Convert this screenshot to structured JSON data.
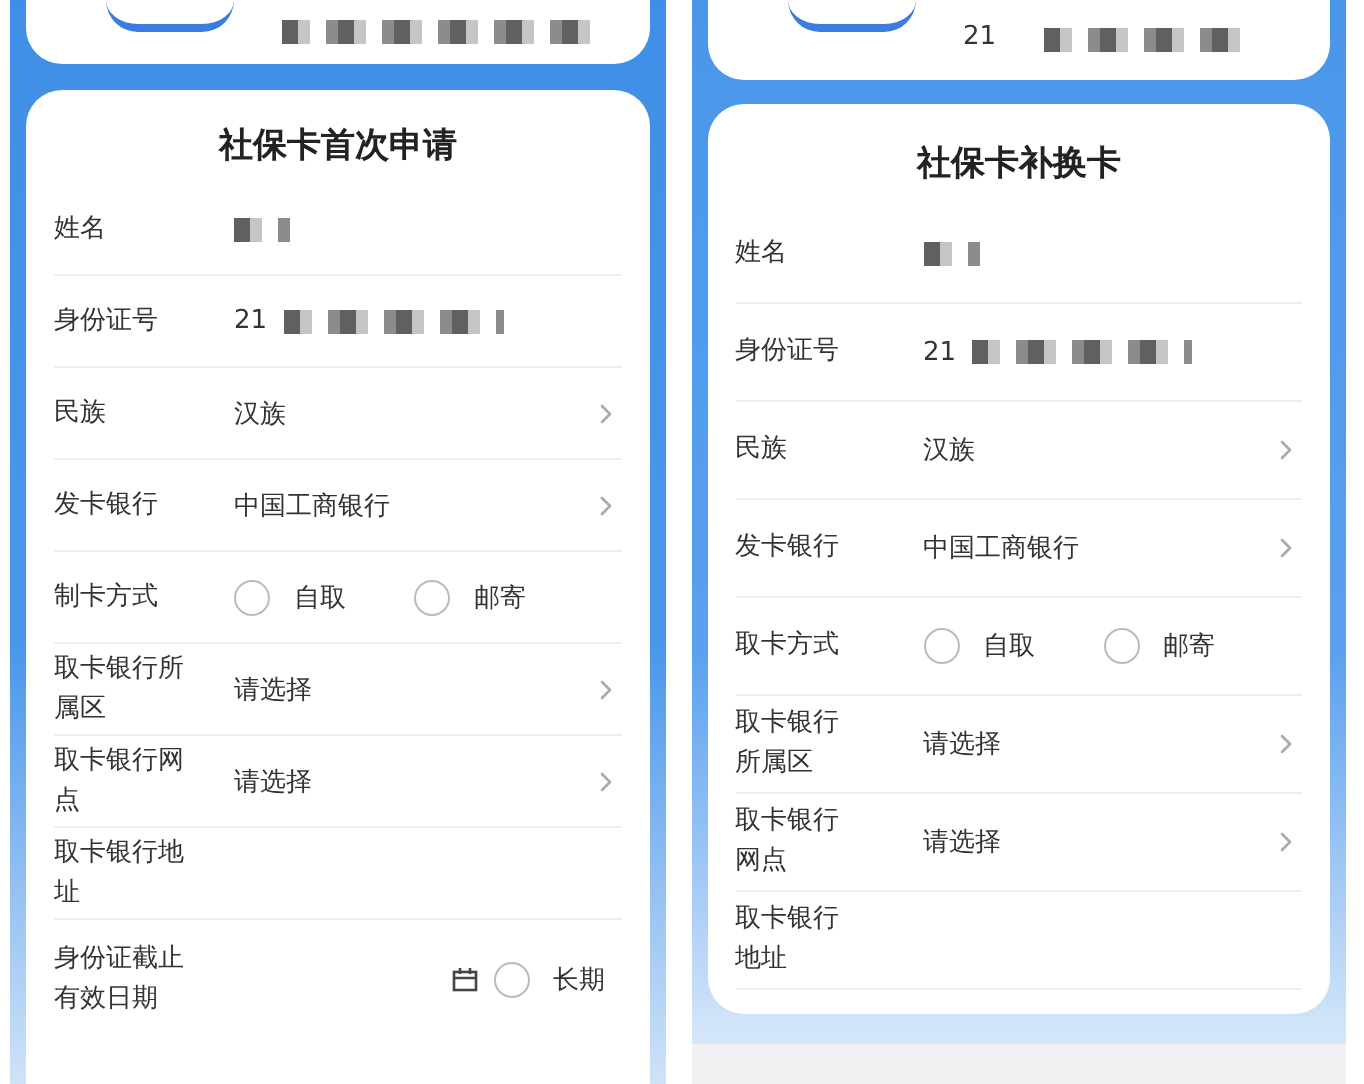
{
  "panels": [
    {
      "title": "社保卡首次申请",
      "rows": [
        {
          "kind": "masked",
          "label": "姓名"
        },
        {
          "kind": "masked",
          "label": "身份证号",
          "value": "21"
        },
        {
          "kind": "select",
          "label": "民族",
          "value": "汉族"
        },
        {
          "kind": "select",
          "label": "发卡银行",
          "value": "中国工商银行"
        },
        {
          "kind": "radio",
          "label": "制卡方式",
          "options": [
            {
              "label": "自取",
              "selected": false
            },
            {
              "label": "邮寄",
              "selected": false
            }
          ]
        },
        {
          "kind": "select",
          "label": "取卡银行所属区",
          "value": "请选择"
        },
        {
          "kind": "select",
          "label": "取卡银行网点",
          "value": "请选择"
        },
        {
          "kind": "text",
          "label": "取卡银行地址"
        },
        {
          "kind": "date",
          "label": "身份证截止有效日期",
          "options": [
            {
              "label": "长期",
              "selected": false
            }
          ]
        }
      ]
    },
    {
      "top_card": {
        "value": "21"
      },
      "title": "社保卡补换卡",
      "rows": [
        {
          "kind": "masked",
          "label": "姓名"
        },
        {
          "kind": "masked",
          "label": "身份证号",
          "value": "21"
        },
        {
          "kind": "select",
          "label": "民族",
          "value": "汉族"
        },
        {
          "kind": "select",
          "label": "发卡银行",
          "value": "中国工商银行"
        },
        {
          "kind": "radio",
          "label": "取卡方式",
          "options": [
            {
              "label": "自取",
              "selected": false
            },
            {
              "label": "邮寄",
              "selected": false
            }
          ]
        },
        {
          "kind": "select",
          "label": "取卡银行所属区",
          "value": "请选择"
        },
        {
          "kind": "select",
          "label": "取卡银行网点",
          "value": "请选择"
        },
        {
          "kind": "text",
          "label": "取卡银行地址"
        }
      ]
    }
  ]
}
